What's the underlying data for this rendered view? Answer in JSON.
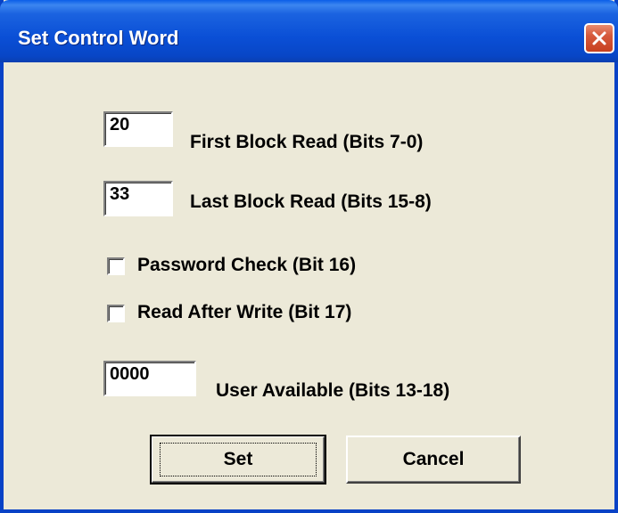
{
  "window": {
    "title": "Set Control Word"
  },
  "fields": {
    "first_block": {
      "value": "20",
      "label": "First Block Read (Bits 7-0)"
    },
    "last_block": {
      "value": "33",
      "label": "Last Block Read (Bits 15-8)"
    },
    "user_available": {
      "value": "0000",
      "label": "User Available (Bits 13-18)"
    }
  },
  "checkboxes": {
    "password_check": {
      "label": "Password Check (Bit 16)",
      "checked": false
    },
    "read_after_write": {
      "label": "Read After Write (Bit 17)",
      "checked": false
    }
  },
  "buttons": {
    "set_label": "Set",
    "cancel_label": "Cancel"
  },
  "icons": {
    "close": "close-icon"
  },
  "colors": {
    "titlebar": "#0a4fd6",
    "dialog_bg": "#ece9d8",
    "close_button": "#d65a3c"
  }
}
